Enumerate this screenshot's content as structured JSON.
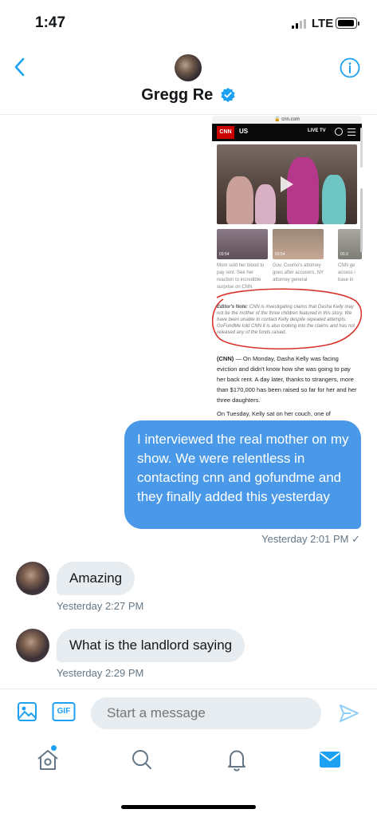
{
  "status_bar": {
    "time": "1:47",
    "carrier": "LTE"
  },
  "header": {
    "name": "Gregg Re"
  },
  "shared_image": {
    "url": "cnn.com",
    "logo": "CNN",
    "section": "US",
    "live": "LIVE TV",
    "thumb1_duration": "03:54",
    "thumb2_duration": "03:54",
    "thumb3_duration": "03:3",
    "caption1": "Mom sold her blood to pay rent. See her reaction to incredible surprise on CNN",
    "caption2": "Gov. Cuomo's attorney goes after accusers, NY attorney general",
    "caption3": "CNN ge access i base in",
    "note_label": "Editor's Note:",
    "note_text": "CNN is investigating claims that Dasha Kelly may not be the mother of the three children featured in this story. We have been unable to contact Kelly despite repeated attempts. GoFundMe told CNN it is also looking into the claims and has not released any of the funds raised.",
    "body_lead": "(CNN)",
    "body_text": "— On Monday, Dasha Kelly was facing eviction and didn't know how she was going to pay her back rent. A day later, thanks to strangers, more than $170,000 has been raised so far for her and her three daughters.",
    "body_tail": "On Tuesday, Kelly sat on her couch, one of"
  },
  "messages": [
    {
      "direction": "out",
      "text": "I interviewed the real mother on my show. We were relentless in contacting cnn and gofundme and they finally added this yesterday",
      "time": "Yesterday 2:01 PM ✓"
    },
    {
      "direction": "in",
      "text": "Amazing",
      "time": "Yesterday 2:27 PM"
    },
    {
      "direction": "in",
      "text": "What is the landlord saying",
      "time": "Yesterday 2:29 PM"
    }
  ],
  "composer": {
    "placeholder": "Start a message",
    "gif_label": "GIF"
  },
  "colors": {
    "accent": "#1da1f2",
    "outgoing_bubble": "#4a99e9",
    "incoming_bubble": "#e6ecf0"
  },
  "icons": {
    "back": "chevron-left-icon",
    "info": "info-icon",
    "verified": "verified-badge-icon",
    "image": "image-icon",
    "gif": "gif-icon",
    "send": "send-icon",
    "home": "home-icon",
    "search": "search-icon",
    "notifications": "bell-icon",
    "messages": "mail-icon"
  }
}
